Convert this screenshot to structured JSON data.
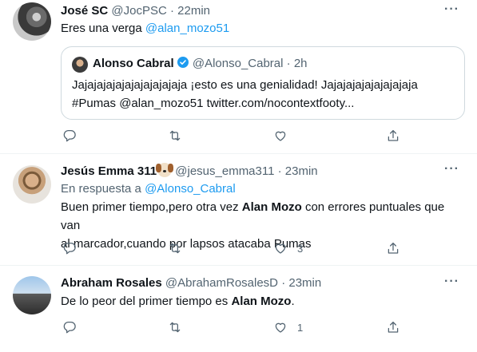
{
  "tweets": [
    {
      "name": "José SC",
      "handle": "@JocPSC",
      "sep": "·",
      "time": "22min",
      "text_prefix": "Eres una verga ",
      "text_mention": "@alan_mozo51",
      "quote": {
        "name": "Alonso Cabral",
        "handle": "@Alonso_Cabral",
        "sep": "·",
        "time": "2h",
        "line1": "Jajajajajajajajajajajaja ¡esto es una genialidad! Jajajajajajajajajaja",
        "line2": "#Pumas @alan_mozo51 twitter.com/nocontextfooty..."
      }
    },
    {
      "name": "Jesús Emma 311",
      "emoji_icon": "dog-face-icon",
      "handle": "@jesus_emma311",
      "sep": "·",
      "time": "23min",
      "reply_prefix": "En respuesta a ",
      "reply_mention": "@Alonso_Cabral",
      "text_a": "Buen primer tiempo,pero otra vez ",
      "text_bold": "Alan Mozo",
      "text_b": " con errores puntuales que van",
      "text_line2": "al marcador,cuando por lapsos atacaba Pumas",
      "like_count": "3"
    },
    {
      "name": "Abraham Rosales",
      "handle": "@AbrahamRosalesD",
      "sep": "·",
      "time": "23min",
      "text_a": "De lo peor del primer tiempo es ",
      "text_bold": "Alan Mozo",
      "text_b": ".",
      "like_count": "1"
    }
  ],
  "more_label": "···",
  "colors": {
    "accent": "#1d9bf0",
    "text": "#0f1419",
    "muted": "#536471",
    "border": "#cfd9de"
  }
}
